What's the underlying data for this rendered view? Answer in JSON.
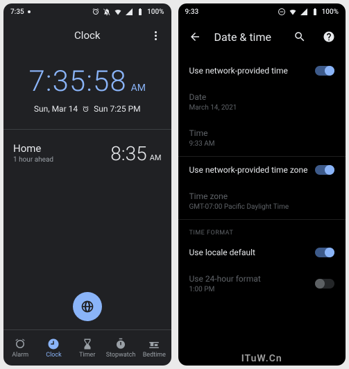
{
  "left": {
    "status": {
      "time": "7:35",
      "battery": "100%"
    },
    "title": "Clock",
    "clock": {
      "time": "7:35:58",
      "ampm": "AM",
      "date": "Sun, Mar 14",
      "alarm": "Sun 7:25 PM"
    },
    "world": {
      "city": "Home",
      "offset": "1 hour ahead",
      "time": "8:35",
      "ampm": "AM"
    },
    "nav": {
      "alarm": "Alarm",
      "clock": "Clock",
      "timer": "Timer",
      "stopwatch": "Stopwatch",
      "bedtime": "Bedtime"
    }
  },
  "right": {
    "status": {
      "time": "9:33",
      "battery": "100%"
    },
    "title": "Date & time",
    "items": {
      "netTime": {
        "label": "Use network-provided time"
      },
      "date": {
        "label": "Date",
        "value": "March 14, 2021"
      },
      "time": {
        "label": "Time",
        "value": "9:33 AM"
      },
      "netTz": {
        "label": "Use network-provided time zone"
      },
      "tz": {
        "label": "Time zone",
        "value": "GMT-07:00 Pacific Daylight Time"
      },
      "section": "Time format",
      "locale": {
        "label": "Use locale default"
      },
      "h24": {
        "label": "Use 24-hour format",
        "value": "1:00 PM"
      }
    }
  },
  "watermark": "ITuW.Cn"
}
